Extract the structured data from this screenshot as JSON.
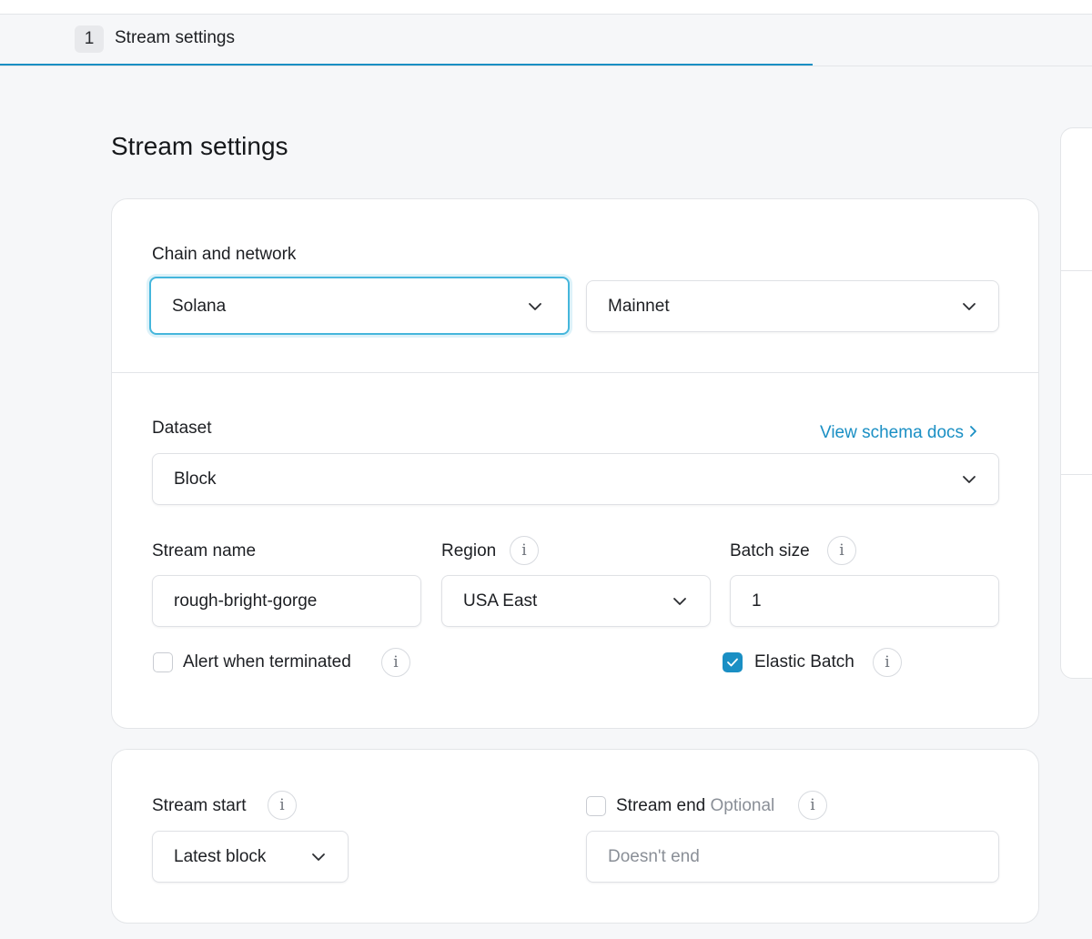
{
  "stepper": {
    "step_number": "1",
    "step_label": "Stream settings"
  },
  "page": {
    "title": "Stream settings"
  },
  "chain_section": {
    "label": "Chain and network",
    "chain_value": "Solana",
    "network_value": "Mainnet"
  },
  "dataset_section": {
    "label": "Dataset",
    "schema_link": "View schema docs",
    "dataset_value": "Block"
  },
  "stream_name": {
    "label": "Stream name",
    "value": "rough-bright-gorge"
  },
  "region": {
    "label": "Region",
    "value": "USA East"
  },
  "batch_size": {
    "label": "Batch size",
    "value": "1"
  },
  "alert_terminated": {
    "label": "Alert when terminated",
    "checked": false
  },
  "elastic_batch": {
    "label": "Elastic Batch",
    "checked": true
  },
  "stream_start": {
    "label": "Stream start",
    "value": "Latest block"
  },
  "stream_end": {
    "label": "Stream end",
    "optional_label": "Optional",
    "placeholder": "Doesn't end",
    "checked": false
  },
  "icons": {
    "info": "info-icon",
    "chevron": "chevron-down-icon",
    "check": "check-icon",
    "link_arrow": "chevron-right-icon"
  },
  "colors": {
    "accent": "#1a8fc4",
    "focus_ring": "#45b6dc",
    "background": "#f6f7f9",
    "card": "#ffffff",
    "muted_text": "#8a8f97"
  }
}
